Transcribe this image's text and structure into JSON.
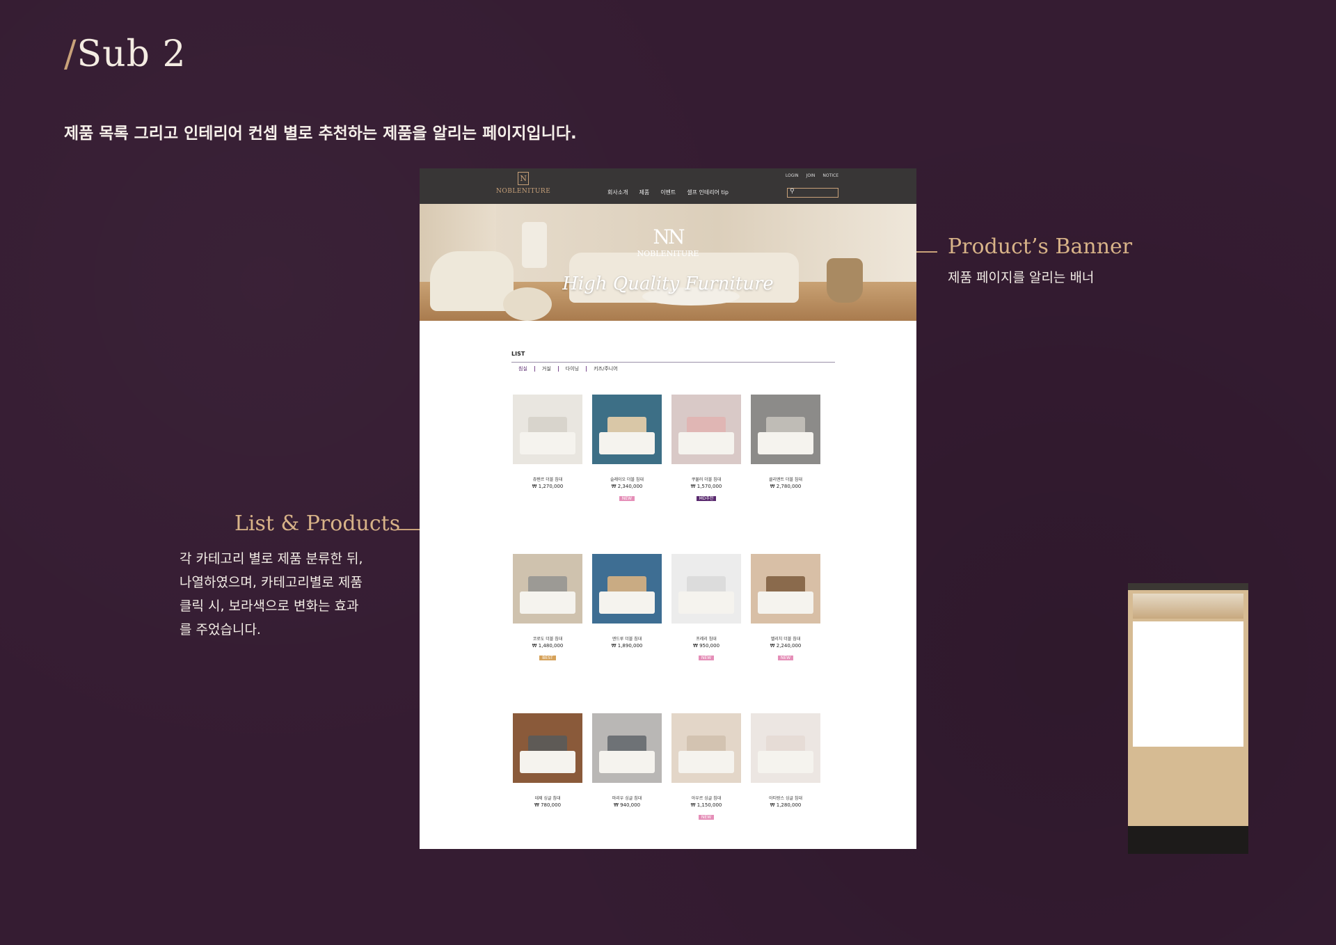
{
  "page": {
    "title_slash": "/",
    "title": "Sub 2",
    "description": "제품 목록 그리고 인테리어 컨셉 별로 추천하는 제품을 알리는 페이지입니다."
  },
  "mockup": {
    "logo_mark": "N",
    "logo_text": "NOBLENITURE",
    "nav": [
      "회사소개",
      "제품",
      "이벤트",
      "셀프 인테리어 tip"
    ],
    "util": [
      "LOGIN",
      "JOIN",
      "NOTICE"
    ],
    "search_icon": "search-icon",
    "banner": {
      "mark": "NN",
      "name": "NOBLENITURE",
      "script": "High Quality Furniture"
    },
    "list_title": "LIST",
    "tabs": [
      "침실",
      "거실",
      "다이닝",
      "키즈/주니어"
    ],
    "active_tab": 0,
    "products": [
      {
        "name": "쥬텐르 더블 침대",
        "price": "₩ 1,270,000",
        "badge": "",
        "badge_color": "",
        "wall": "#e9e6e0",
        "head": "#d8d4cc"
      },
      {
        "name": "슬레이오 더블 침대",
        "price": "₩ 2,340,000",
        "badge": "NEW",
        "badge_color": "#e58fb8",
        "wall": "#3d6f86",
        "head": "#d9c7a7"
      },
      {
        "name": "쿠뮬러 더블 침대",
        "price": "₩ 1,570,000",
        "badge": "MD추천",
        "badge_color": "#5a2a6f",
        "wall": "#d9c9c7",
        "head": "#e0b6b4"
      },
      {
        "name": "클리엔트 더블 침대",
        "price": "₩ 2,780,000",
        "badge": "",
        "badge_color": "",
        "wall": "#8c8b89",
        "head": "#bfbcb6"
      },
      {
        "name": "코로도 더블 침대",
        "price": "₩ 1,480,000",
        "badge": "BEST",
        "badge_color": "#d6a25a",
        "wall": "#cfc2ae",
        "head": "#9c9a95"
      },
      {
        "name": "엔드루 더블 침대",
        "price": "₩ 1,890,000",
        "badge": "",
        "badge_color": "",
        "wall": "#3e6e93",
        "head": "#c9ab83"
      },
      {
        "name": "프레리 침대",
        "price": "₩ 950,000",
        "badge": "NEW",
        "badge_color": "#e58fb8",
        "wall": "#ececec",
        "head": "#dcdcdc"
      },
      {
        "name": "벨리치 더블 침대",
        "price": "₩ 2,240,000",
        "badge": "NEW",
        "badge_color": "#e58fb8",
        "wall": "#d8bfa6",
        "head": "#8a6a4c"
      },
      {
        "name": "데제 싱글 침대",
        "price": "₩ 780,000",
        "badge": "",
        "badge_color": "",
        "wall": "#8a5a3a",
        "head": "#5e5a56"
      },
      {
        "name": "마리우 싱글 침대",
        "price": "₩ 940,000",
        "badge": "",
        "badge_color": "",
        "wall": "#b9b7b5",
        "head": "#6e7276"
      },
      {
        "name": "아우르 싱글 침대",
        "price": "₩ 1,150,000",
        "badge": "NEW",
        "badge_color": "#e58fb8",
        "wall": "#e3d6c8",
        "head": "#d3c3b1"
      },
      {
        "name": "아티랑스 싱글 침대",
        "price": "₩ 1,280,000",
        "badge": "",
        "badge_color": "",
        "wall": "#ece6e2",
        "head": "#e6dcd6"
      }
    ]
  },
  "annotations": {
    "banner": {
      "title": "Product’s Banner",
      "text": "제품 페이지를 알리는 배너"
    },
    "list": {
      "title": "List & Products",
      "lines": [
        "각 카테고리 별로 제품 분류한 뒤,",
        "나열하였으며, 카테고리별로 제품",
        "클릭 시, 보라색으로 변화는 효과",
        "를 주었습니다."
      ]
    }
  },
  "colors": {
    "background": "#351c32",
    "accent": "#c9a27a",
    "purple": "#5a2a6f"
  }
}
